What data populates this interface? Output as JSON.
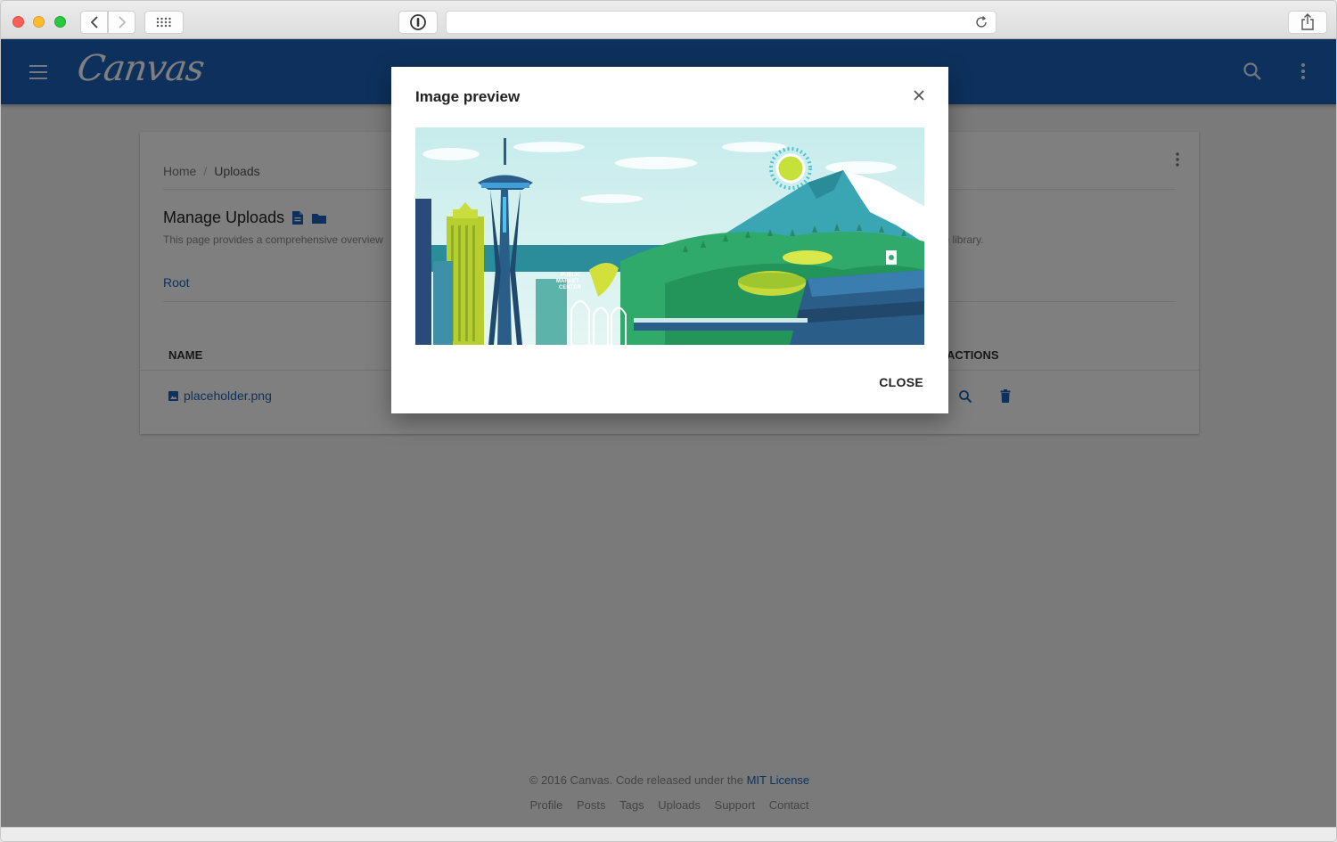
{
  "browser": {
    "url": ""
  },
  "appbar": {
    "logo": "Canvas"
  },
  "breadcrumb": {
    "home": "Home",
    "separator": "/",
    "current": "Uploads"
  },
  "main": {
    "title": "Manage Uploads",
    "description_left": "This page provides a comprehensive overview",
    "description_right": "ne library.",
    "root_link": "Root",
    "columns": {
      "name": "NAME",
      "actions": "ACTIONS"
    },
    "files": [
      {
        "name": "placeholder.png"
      }
    ]
  },
  "footer": {
    "copyright": "© 2016 Canvas. Code released under the",
    "license": "MIT License",
    "links": [
      "Profile",
      "Posts",
      "Tags",
      "Uploads",
      "Support",
      "Contact"
    ]
  },
  "modal": {
    "title": "Image preview",
    "close_label": "CLOSE",
    "image_labels": {
      "market_1": "PUBLIC",
      "market_2": "MARKET",
      "market_3": "CENTER"
    }
  },
  "colors": {
    "brand": "#1b63b8",
    "overlay": "rgba(0,0,0,0.5)"
  },
  "icons": [
    "hamburger-icon",
    "search-icon",
    "more-vert-icon",
    "file-icon",
    "folder-icon",
    "image-file-icon",
    "delete-icon",
    "close-icon"
  ]
}
